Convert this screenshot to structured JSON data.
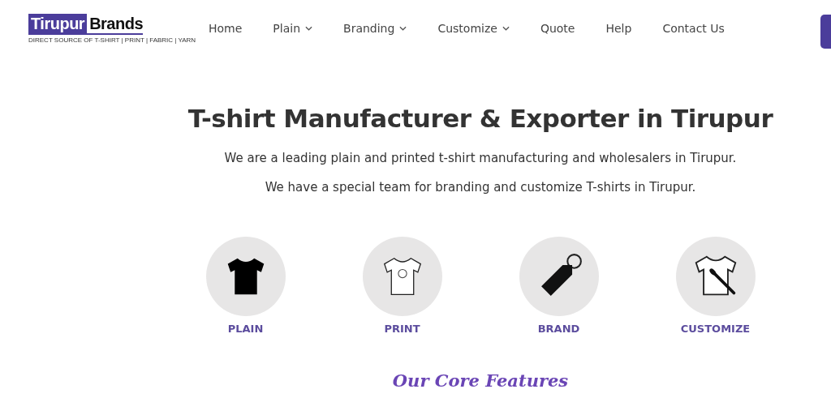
{
  "logo": {
    "word_1": "Tirupur",
    "word_2": "Brands",
    "tagline": "DIRECT SOURCE OF T-SHIRT | PRINT | FABRIC | YARN"
  },
  "nav": [
    {
      "label": "Home",
      "dropdown": false
    },
    {
      "label": "Plain",
      "dropdown": true
    },
    {
      "label": "Branding",
      "dropdown": true
    },
    {
      "label": "Customize",
      "dropdown": true
    },
    {
      "label": "Quote",
      "dropdown": false
    },
    {
      "label": "Help",
      "dropdown": false
    },
    {
      "label": "Contact Us",
      "dropdown": false
    }
  ],
  "hero": {
    "title": "T-shirt Manufacturer & Exporter in Tirupur",
    "paragraphs": [
      "We are a leading plain and printed t-shirt manufacturing and wholesalers in Tirupur.",
      "We have a special team for branding and customize T-shirts in Tirupur."
    ]
  },
  "categories": [
    {
      "label": "PLAIN",
      "kind": "plain"
    },
    {
      "label": "PRINT",
      "kind": "print"
    },
    {
      "label": "BRAND",
      "kind": "brand"
    },
    {
      "label": "CUSTOMIZE",
      "kind": "customize"
    }
  ],
  "section_title": "Our Core Features"
}
